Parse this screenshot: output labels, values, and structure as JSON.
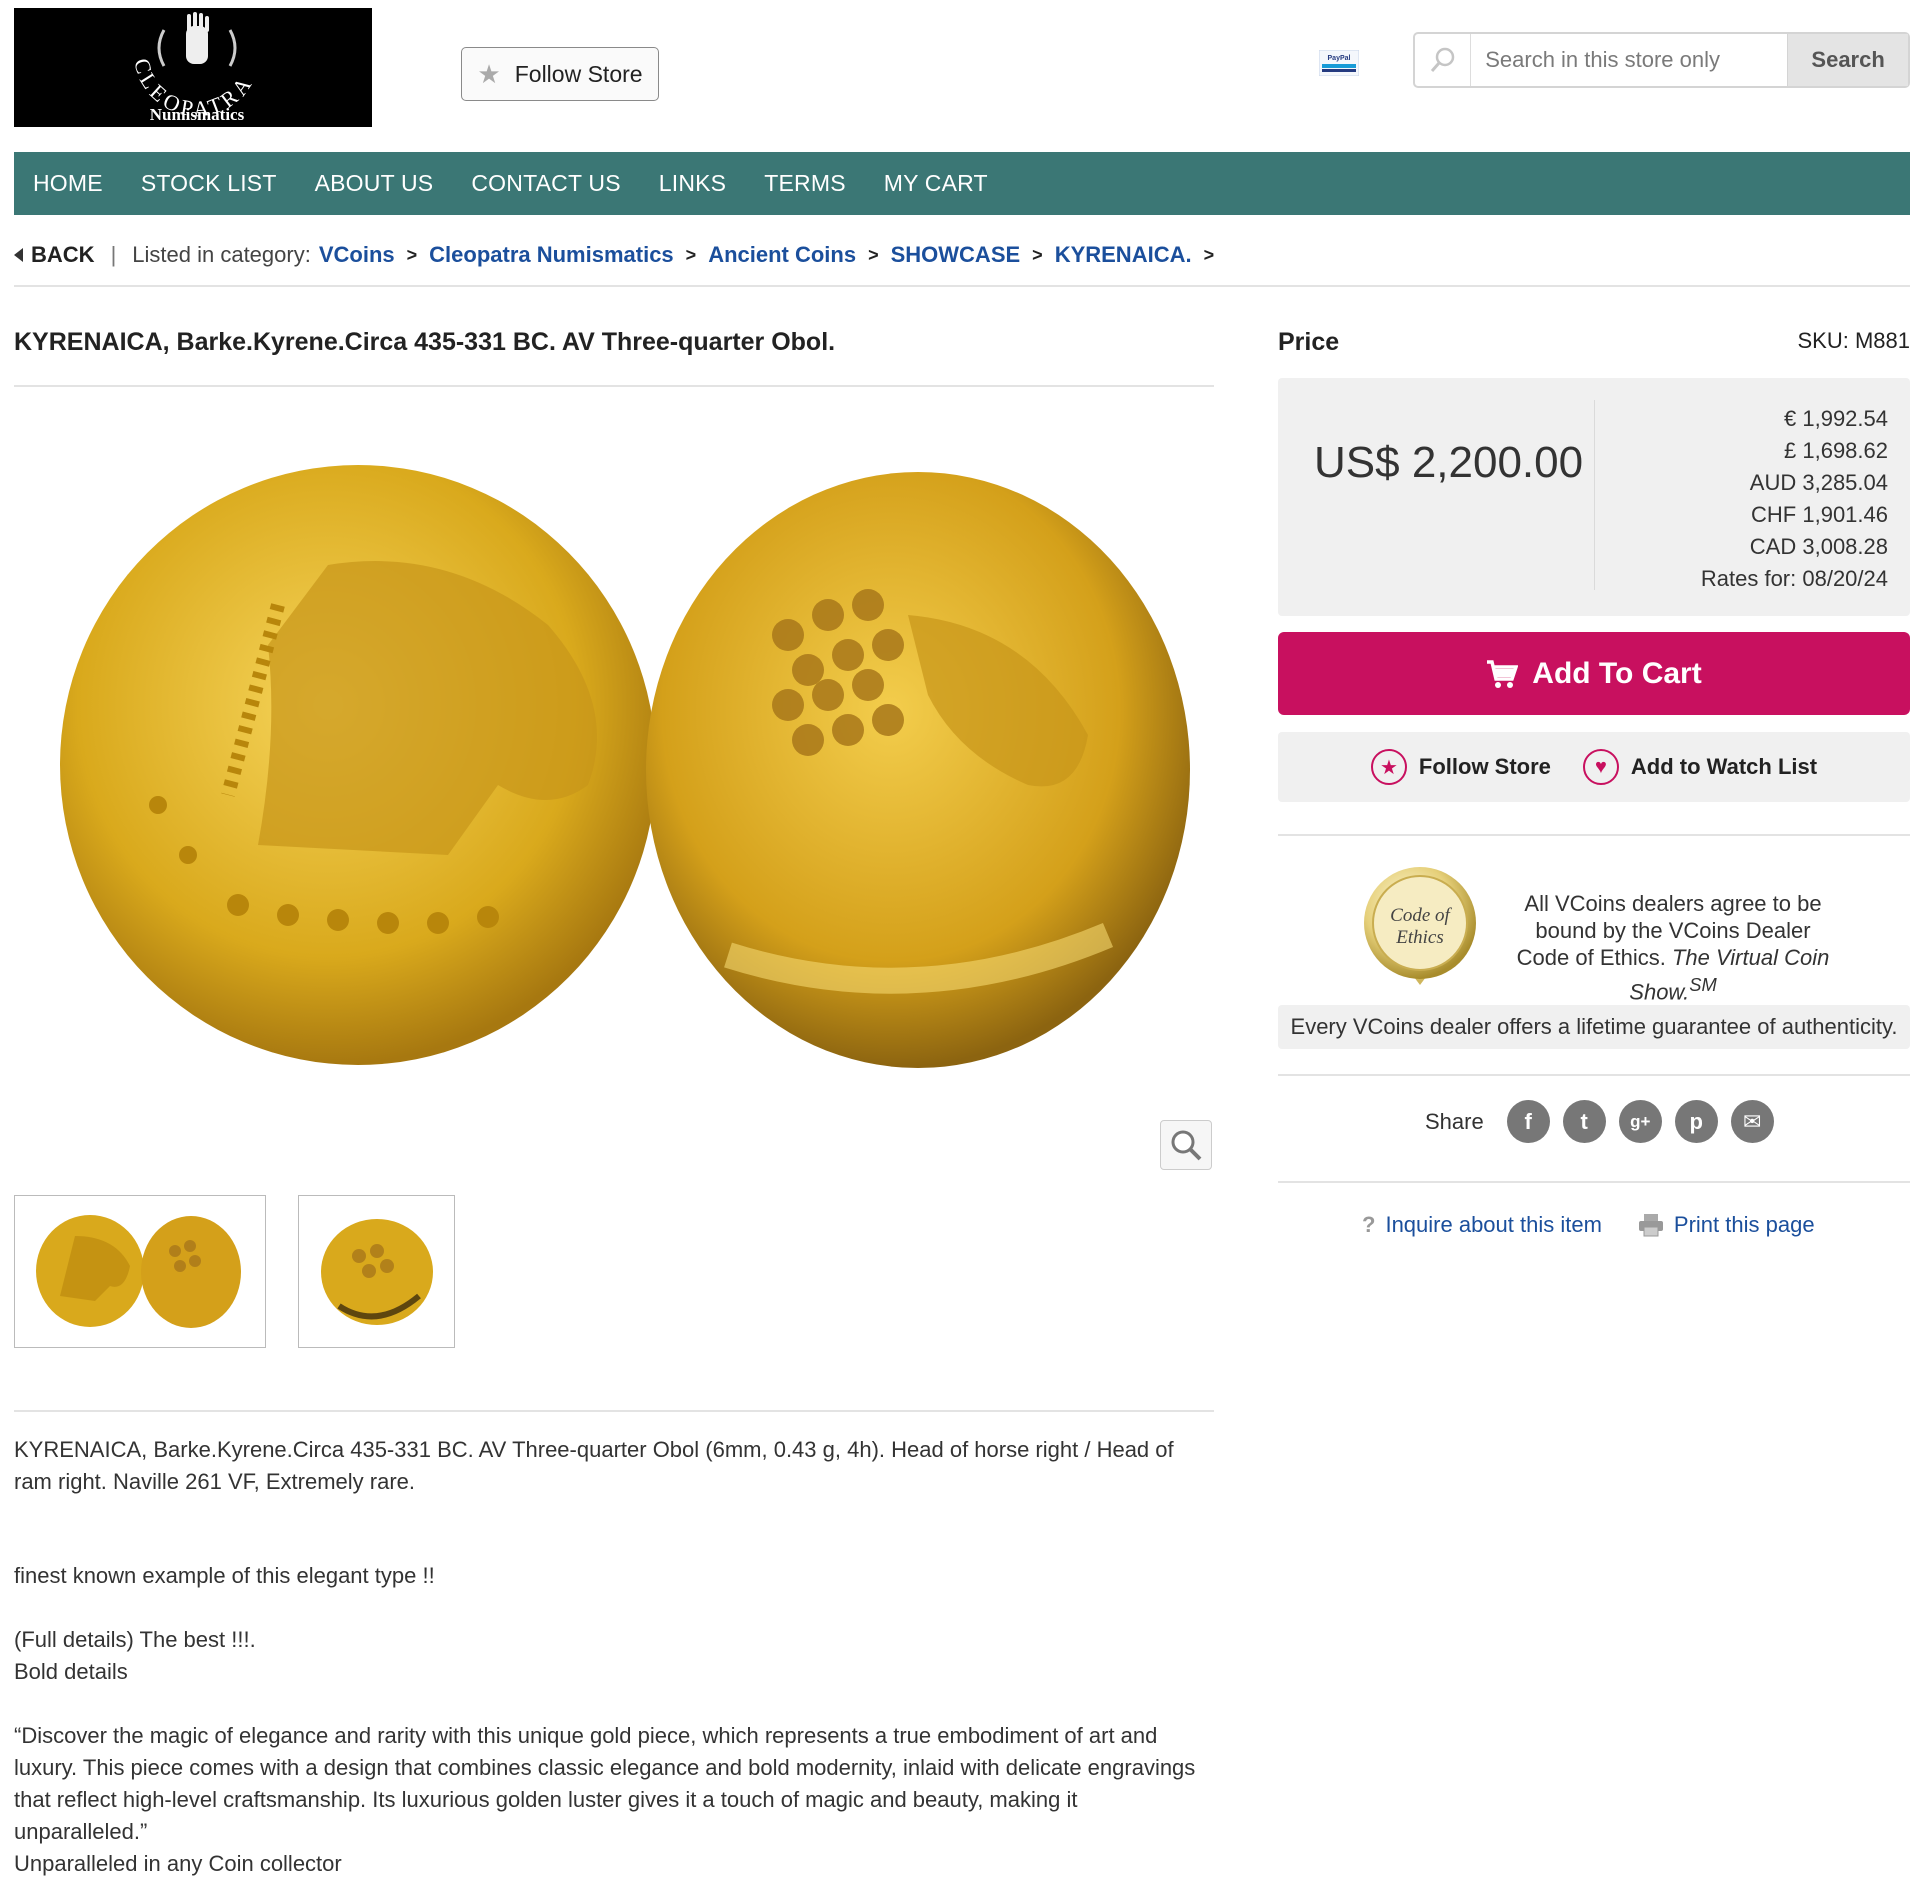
{
  "header": {
    "logo_brand": "CLEOPATRA",
    "logo_sub": "Numismatics",
    "follow_store_label": "Follow Store",
    "paypal_label": "PayPal",
    "search_placeholder": "Search in this store only",
    "search_button": "Search"
  },
  "nav": {
    "items": [
      "HOME",
      "STOCK LIST",
      "ABOUT US",
      "CONTACT US",
      "LINKS",
      "TERMS",
      "MY CART"
    ]
  },
  "breadcrumb": {
    "back": "BACK",
    "listed_label": "Listed in category:",
    "items": [
      "VCoins",
      "Cleopatra Numismatics",
      "Ancient Coins",
      "SHOWCASE",
      "KYRENAICA."
    ]
  },
  "product": {
    "title": "KYRENAICA, Barke.Kyrene.Circa 435-331 BC. AV Three-quarter Obol.",
    "description": [
      "KYRENAICA, Barke.Kyrene.Circa 435-331 BC. AV Three-quarter Obol (6mm, 0.43 g, 4h). Head of horse right / Head of ram right. Naville 261 VF, Extremely rare.",
      "finest known example of this elegant type !!",
      "(Full details) The best !!!.",
      "Bold details",
      "“Discover the magic of elegance and rarity with this unique gold piece, which represents a true embodiment of art and luxury. This piece comes with a design that combines classic elegance and bold modernity, inlaid with delicate engravings that reflect high-level craftsmanship. Its luxurious golden luster gives it a touch of magic and beauty, making it unparalleled.”",
      "Unparalleled in any Coin collector"
    ]
  },
  "pricing": {
    "price_label": "Price",
    "sku": "SKU: M881",
    "price": "US$ 2,200.00",
    "conversions": [
      "€ 1,992.54",
      "£ 1,698.62",
      "AUD 3,285.04",
      "CHF 1,901.46",
      "CAD 3,008.28"
    ],
    "rates": "Rates for: 08/20/24",
    "add_to_cart": "Add To Cart",
    "follow_store": "Follow Store",
    "watch_list": "Add to Watch List"
  },
  "ethics": {
    "seal_line1": "Code of",
    "seal_line2": "Ethics",
    "text_plain": "All VCoins dealers agree to be bound by the VCoins Dealer Code of Ethics.",
    "text_italic": "The Virtual Coin Show.",
    "text_sup": "SM",
    "guarantee": "Every VCoins dealer offers a lifetime guarantee of authenticity."
  },
  "share": {
    "label": "Share",
    "buttons": [
      "f",
      "t",
      "g+",
      "p",
      "✉"
    ]
  },
  "links": {
    "inquire": "Inquire about this item",
    "print": "Print this page"
  },
  "colors": {
    "nav_bg": "#3b7775",
    "accent": "#c8105f",
    "link": "#1b4f9c",
    "gold": "#d9a91c"
  }
}
